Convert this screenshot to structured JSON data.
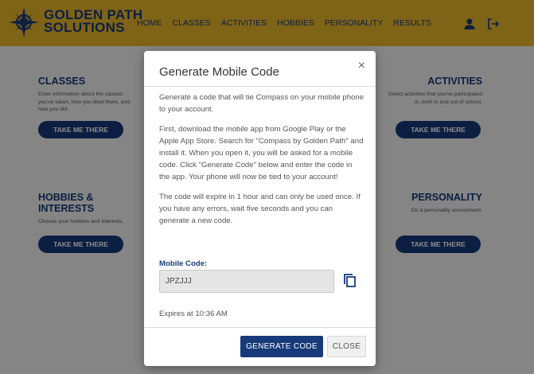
{
  "brand": {
    "line1": "GOLDEN PATH",
    "line2": "SOLUTIONS"
  },
  "nav": [
    "HOME",
    "CLASSES",
    "ACTIVITIES",
    "HOBBIES",
    "PERSONALITY",
    "RESULTS"
  ],
  "header_icons": [
    "user-icon",
    "logout-icon"
  ],
  "sections": {
    "classes": {
      "title": "CLASSES",
      "desc": "Enter information about the classes you've taken, how you liked them, and how you did.",
      "button": "TAKE ME THERE"
    },
    "activities": {
      "title": "ACTIVITIES",
      "desc": "Select activities that you've participated in, both in and out of school.",
      "button": "TAKE ME THERE"
    },
    "hobbies": {
      "title": "HOBBIES & INTERESTS",
      "desc": "Choose your hobbies and interests.",
      "button": "TAKE ME THERE"
    },
    "personality": {
      "title": "PERSONALITY",
      "desc": "Do a personality assessment.",
      "button": "TAKE ME THERE"
    }
  },
  "modal": {
    "title": "Generate Mobile Code",
    "close_symbol": "×",
    "paragraphs": [
      "Generate a code that will tie Compass on your mobile phone to your account.",
      "First, download the mobile app from Google Play or the Apple App Store. Search for \"Compass by Golden Path\" and install it. When you open it, you will be asked for a mobile code. Click \"Generate Code\" below and enter the code in the app. Your phone will now be tied to your account!",
      "The code will expire in 1 hour and can only be used once. If you have any errors, wait five seconds and you can generate a new code."
    ],
    "code_label": "Mobile Code:",
    "code_value": "JPZJJJ",
    "expires": "Expires at 10:36 AM",
    "generate_button": "GENERATE CODE",
    "close_button": "CLOSE"
  },
  "colors": {
    "brand_gold": "#e8b52b",
    "brand_navy": "#173a7a"
  }
}
